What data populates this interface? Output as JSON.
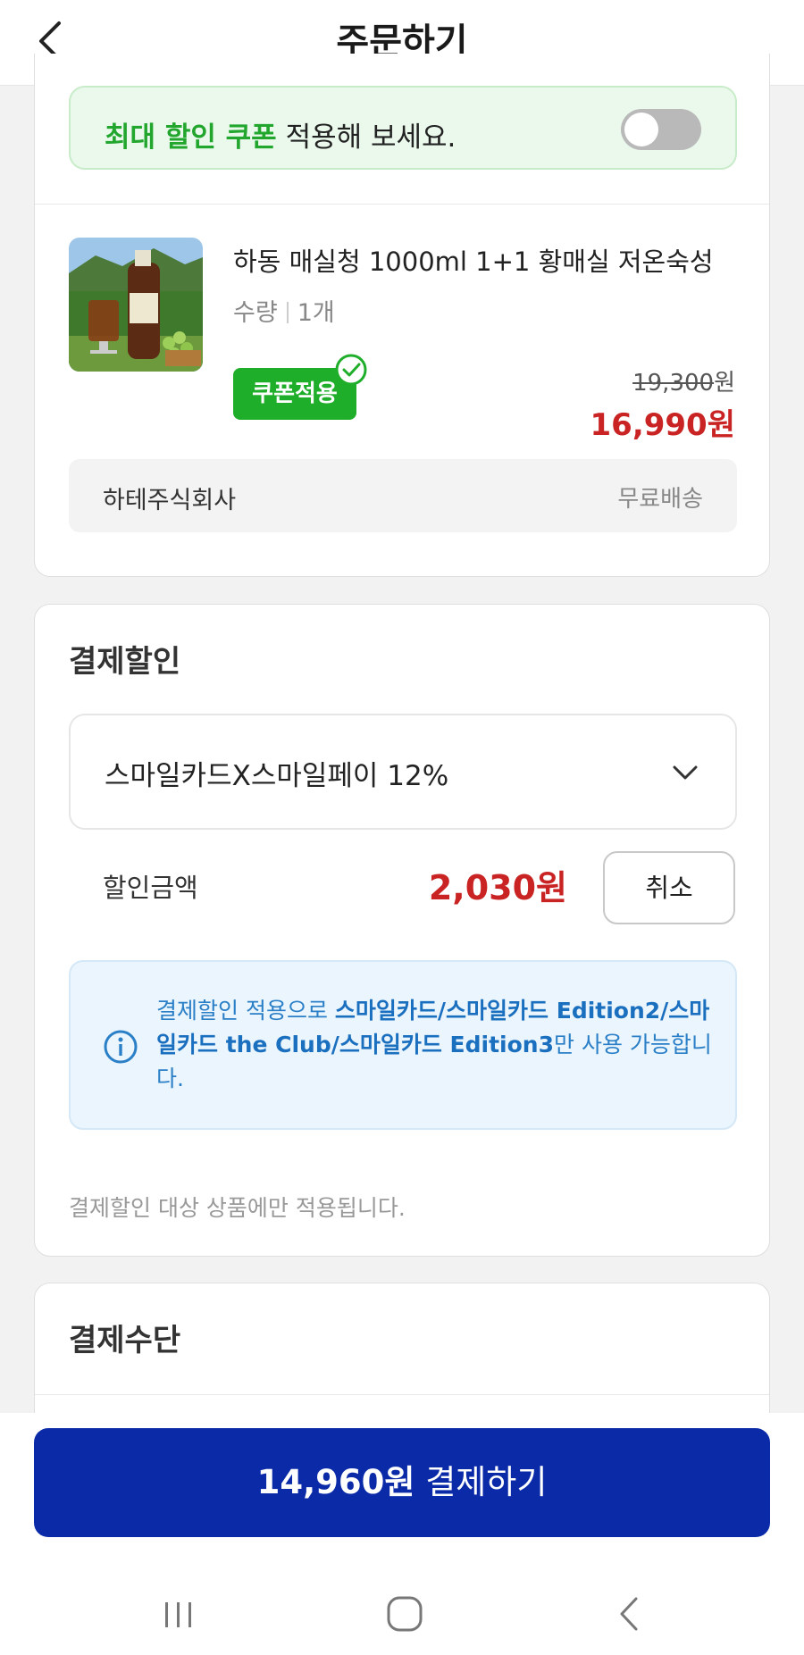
{
  "header": {
    "title": "주문하기"
  },
  "coupon_banner": {
    "highlight": "최대 할인 쿠폰",
    "text": " 적용해 보세요.",
    "toggle_on": false
  },
  "product": {
    "name": "하동 매실청 1000ml 1+1 황매실 저온숙성",
    "qty_label": "수량",
    "qty_value": "1개",
    "coupon_badge": "쿠폰적용",
    "original_price": "19,300",
    "original_unit": "원",
    "sale_price": "16,990원",
    "seller": "하테주식회사",
    "shipping": "무료배송"
  },
  "payment_discount": {
    "title": "결제할인",
    "selected_option": "스마일카드X스마일페이 12%",
    "amount_label": "할인금액",
    "amount": "2,030원",
    "cancel_label": "취소",
    "info_prefix": "결제할인 적용으로 ",
    "info_cards": "스마일카드/스마일카드 Edition2/스마일카드 the Club/스마일카드 Edition3",
    "info_suffix": "만 사용 가능합니다.",
    "note": "결제할인 대상 상품에만 적용됩니다."
  },
  "payment_method": {
    "title": "결제수단"
  },
  "pay_button": {
    "amount": "14,960원",
    "label": " 결제하기"
  },
  "colors": {
    "primary": "#0a2aa8",
    "price_red": "#c92323",
    "coupon_green": "#1fae2a",
    "info_blue": "#2a7fc7"
  }
}
